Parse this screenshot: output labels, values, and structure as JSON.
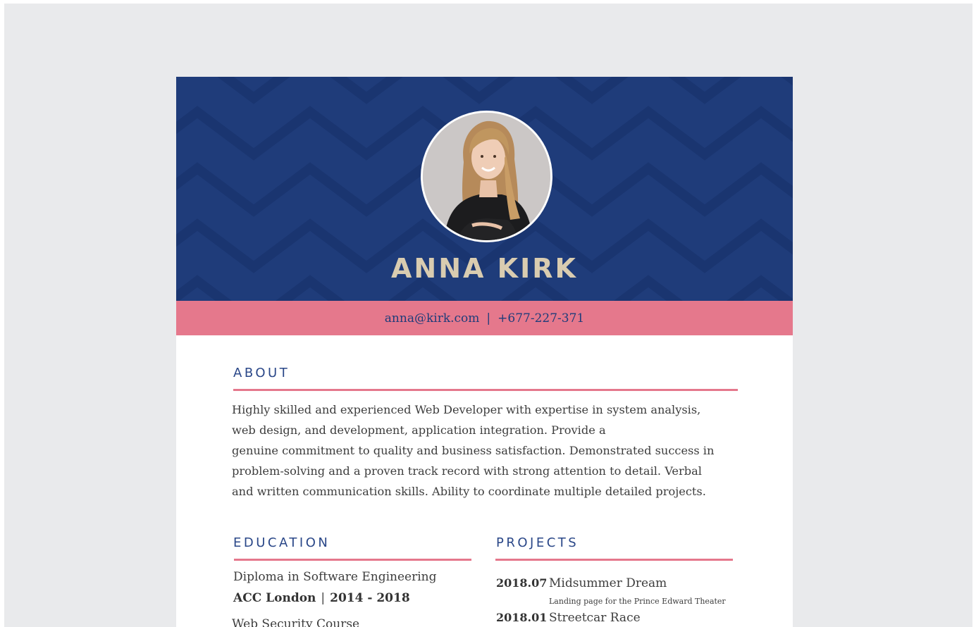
{
  "colors": {
    "header_bg": "#1f3c7a",
    "accent_pink": "#e5788c",
    "name_color": "#d9ccb0",
    "heading_color": "#2a4788",
    "page_bg": "#e9eaec"
  },
  "profile": {
    "name": "ANNA KIRK",
    "photo_icon": "profile-photo"
  },
  "contact": {
    "email": "anna@kirk.com",
    "separator": "|",
    "phone": "+677-227-371"
  },
  "about": {
    "title": "ABOUT",
    "lines": [
      "Highly skilled and experienced Web Developer with expertise in system analysis,",
      "web design, and development, application integration. Provide a",
      "genuine commitment to quality and business satisfaction. Demonstrated success in",
      "problem-solving and a proven track record with strong attention to detail. Verbal",
      "and written communication skills. Ability to coordinate multiple detailed projects."
    ]
  },
  "education": {
    "title": "EDUCATION",
    "items": [
      {
        "degree": "Diploma in Software Engineering",
        "school": "ACC London",
        "separator": "|",
        "years": "2014 - 2018"
      },
      {
        "degree": "Web Security Course"
      }
    ]
  },
  "projects": {
    "title": "PROJECTS",
    "items": [
      {
        "date": "2018.07",
        "name": "Midsummer Dream",
        "description": "Landing page for the Prince Edward Theater"
      },
      {
        "date": "2018.01",
        "name": "Streetcar Race"
      }
    ]
  }
}
